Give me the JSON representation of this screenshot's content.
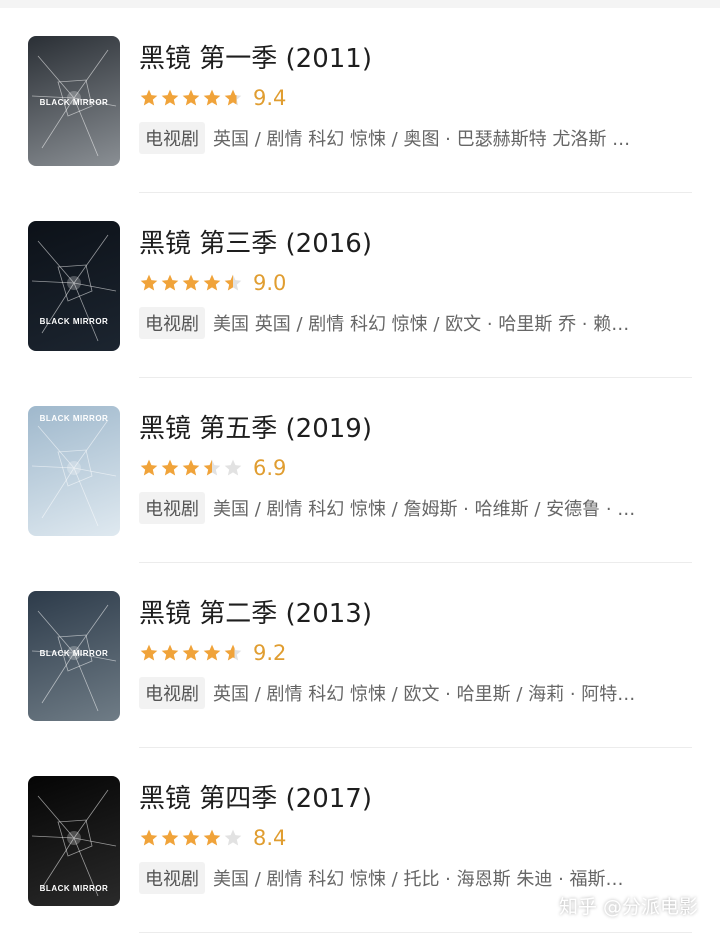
{
  "colors": {
    "star": "#f0a33a",
    "star_empty": "#e2e2e2",
    "score": "#e09d30"
  },
  "items": [
    {
      "title": "黑镜 第一季 (2011)",
      "rating": 4.7,
      "score": "9.4",
      "tag": "电视剧",
      "meta": "英国 / 剧情 科幻 惊悚 / 奥图 · 巴瑟赫斯特 尤洛斯 …",
      "poster_label": "BLACK MIRROR"
    },
    {
      "title": "黑镜 第三季 (2016)",
      "rating": 4.5,
      "score": "9.0",
      "tag": "电视剧",
      "meta": "美国 英国 / 剧情 科幻 惊悚 / 欧文 · 哈里斯 乔 · 赖…",
      "poster_label": "BLACK MIRROR"
    },
    {
      "title": "黑镜 第五季 (2019)",
      "rating": 3.5,
      "score": "6.9",
      "tag": "电视剧",
      "meta": "美国 / 剧情 科幻 惊悚 / 詹姆斯 · 哈维斯 / 安德鲁 · …",
      "poster_label": "BLACK MIRROR"
    },
    {
      "title": "黑镜 第二季 (2013)",
      "rating": 4.6,
      "score": "9.2",
      "tag": "电视剧",
      "meta": "英国 / 剧情 科幻 惊悚 / 欧文 · 哈里斯 / 海莉 · 阿特…",
      "poster_label": "BLACK MIRROR"
    },
    {
      "title": "黑镜 第四季 (2017)",
      "rating": 4.0,
      "score": "8.4",
      "tag": "电视剧",
      "meta": "美国 / 剧情 科幻 惊悚 / 托比 · 海恩斯 朱迪 · 福斯…",
      "poster_label": "BLACK MIRROR"
    }
  ],
  "watermark": "知乎 @分派电影"
}
